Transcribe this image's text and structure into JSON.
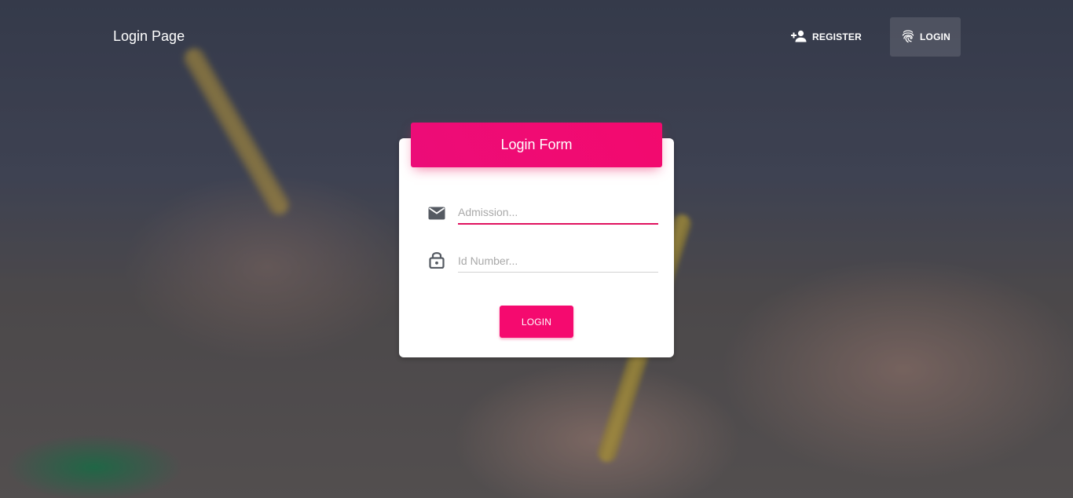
{
  "navbar": {
    "brand": "Login Page",
    "register_label": "REGISTER",
    "login_label": "LOGIN"
  },
  "login_form": {
    "title": "Login Form",
    "admission_placeholder": "Admission...",
    "id_placeholder": "Id Number...",
    "submit_label": "LOGIN"
  },
  "icons": {
    "register": "person-add-icon",
    "login": "fingerprint-icon",
    "admission": "email-icon",
    "id_number": "lock-icon"
  },
  "colors": {
    "accent": "#e91e63",
    "header": "#ec0c78"
  }
}
